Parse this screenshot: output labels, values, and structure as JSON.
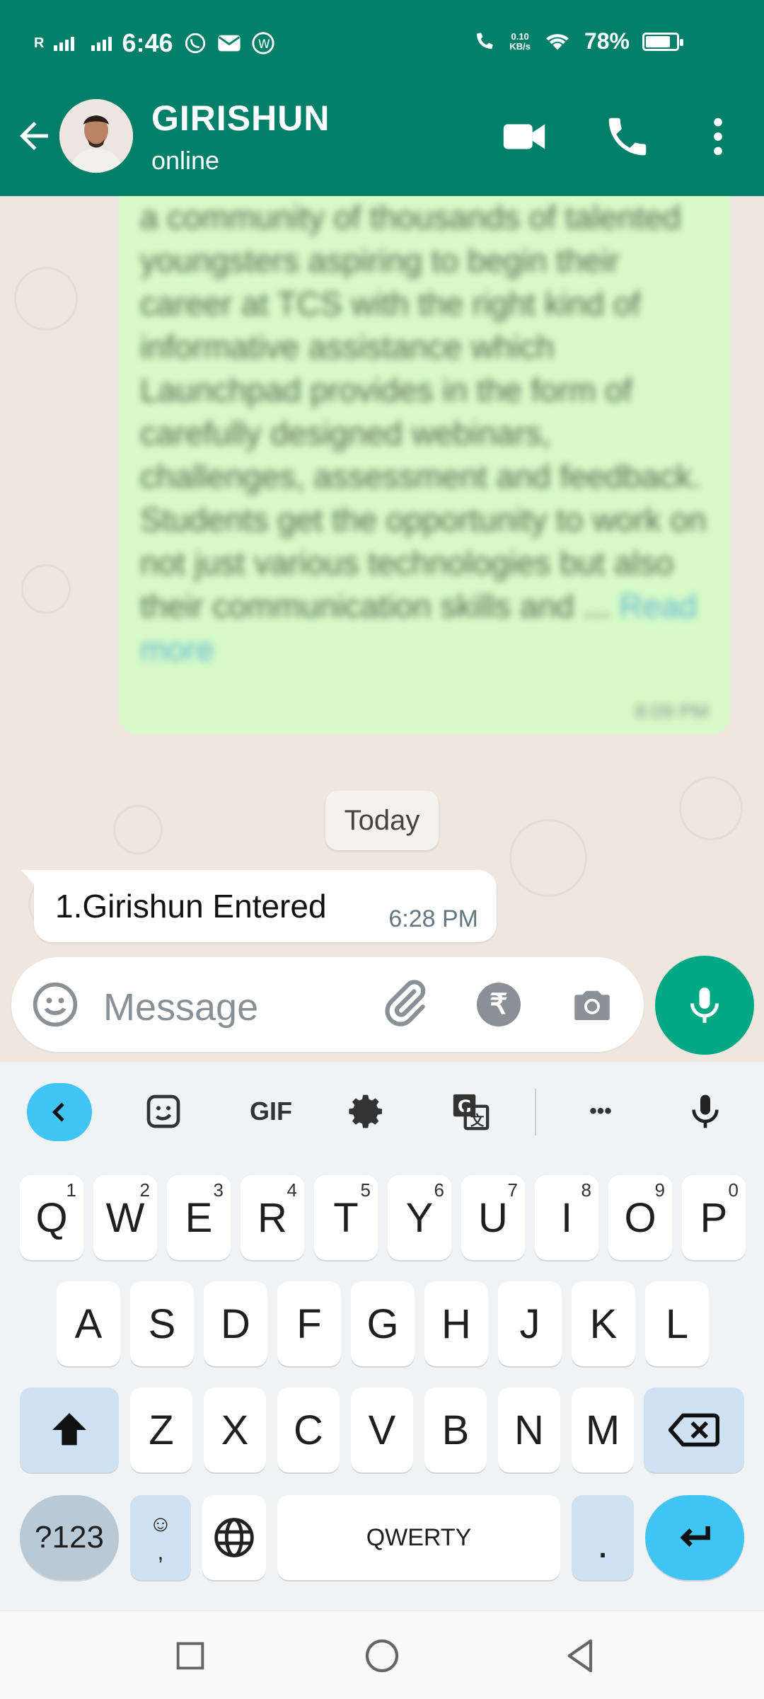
{
  "status_bar": {
    "carrier": "R",
    "time": "6:46",
    "net_speed_value": "0.10",
    "net_speed_unit": "KB/s",
    "battery": "78%",
    "battery_level": 0.78
  },
  "header": {
    "contact_name": "GIRISHUN",
    "contact_status": "online",
    "icons": [
      "back-arrow-icon",
      "video-call-icon",
      "phone-call-icon",
      "more-vert-icon"
    ],
    "background_color": "#008069"
  },
  "chat": {
    "previous_message": {
      "text": "a community of thousands of talented youngsters aspiring to begin their career at TCS with the right kind of informative assistance which Launchpad provides in the form of carefully designed webinars, challenges, assessment and feedback. Students get the opportunity to work on not just various technologies but also their communication skills and ...",
      "read_more": "Read more",
      "time": "8:09 PM"
    },
    "date_chip": "Today",
    "messages": [
      {
        "text": "1.Girishun Entered",
        "time": "6:28 PM"
      }
    ]
  },
  "composer": {
    "placeholder": "Message",
    "rupee_symbol": "₹",
    "accent": "#00a884"
  },
  "keyboard": {
    "toolbar": [
      "back-icon",
      "sticker-icon",
      "GIF",
      "settings-icon",
      "translate-icon",
      "more-icon",
      "mic-icon"
    ],
    "gif_label": "GIF",
    "more_label": "•••",
    "row1": [
      {
        "k": "Q",
        "h": "1"
      },
      {
        "k": "W",
        "h": "2"
      },
      {
        "k": "E",
        "h": "3"
      },
      {
        "k": "R",
        "h": "4"
      },
      {
        "k": "T",
        "h": "5"
      },
      {
        "k": "Y",
        "h": "6"
      },
      {
        "k": "U",
        "h": "7"
      },
      {
        "k": "I",
        "h": "8"
      },
      {
        "k": "O",
        "h": "9"
      },
      {
        "k": "P",
        "h": "0"
      }
    ],
    "row2": [
      "A",
      "S",
      "D",
      "F",
      "G",
      "H",
      "J",
      "K",
      "L"
    ],
    "row3": [
      "Z",
      "X",
      "C",
      "V",
      "B",
      "N",
      "M"
    ],
    "symbols_label": "?123",
    "emoji_comma_top": "☺",
    "emoji_comma_bottom": ",",
    "space_label": "QWERTY",
    "period_label": "."
  },
  "nav_bar": [
    "recents-icon",
    "home-icon",
    "back-icon"
  ]
}
